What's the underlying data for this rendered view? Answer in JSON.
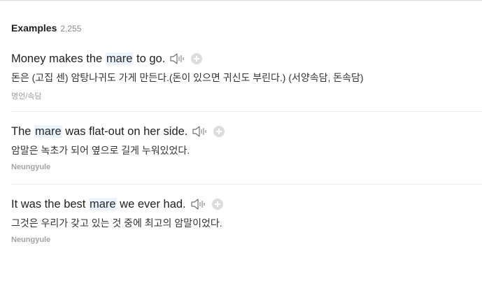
{
  "section": {
    "title": "Examples",
    "count": "2,255"
  },
  "examples": [
    {
      "before": "Money makes the ",
      "highlight": "mare",
      "after": " to go.",
      "translation": "돈은 (고집 센) 암탕나귀도 가게 만든다.(돈이 있으면 귀신도 부린다.) (서양속담, 돈속담)",
      "source": "명언/속담"
    },
    {
      "before": "The ",
      "highlight": "mare",
      "after": " was flat-out on her side.",
      "translation": "암말은 녹초가 되어 옆으로 길게 누워있었다.",
      "source": "Neungyule"
    },
    {
      "before": "It was the best ",
      "highlight": "mare",
      "after": " we ever had.",
      "translation": "그것은 우리가 갖고 있는 것 중에 최고의 암말이었다.",
      "source": "Neungyule"
    }
  ],
  "icons": {
    "speaker": "speaker-icon",
    "add": "plus-circle-icon"
  },
  "colors": {
    "highlight_bg": "#e9f2fd",
    "muted_text": "#9a9a9a"
  }
}
